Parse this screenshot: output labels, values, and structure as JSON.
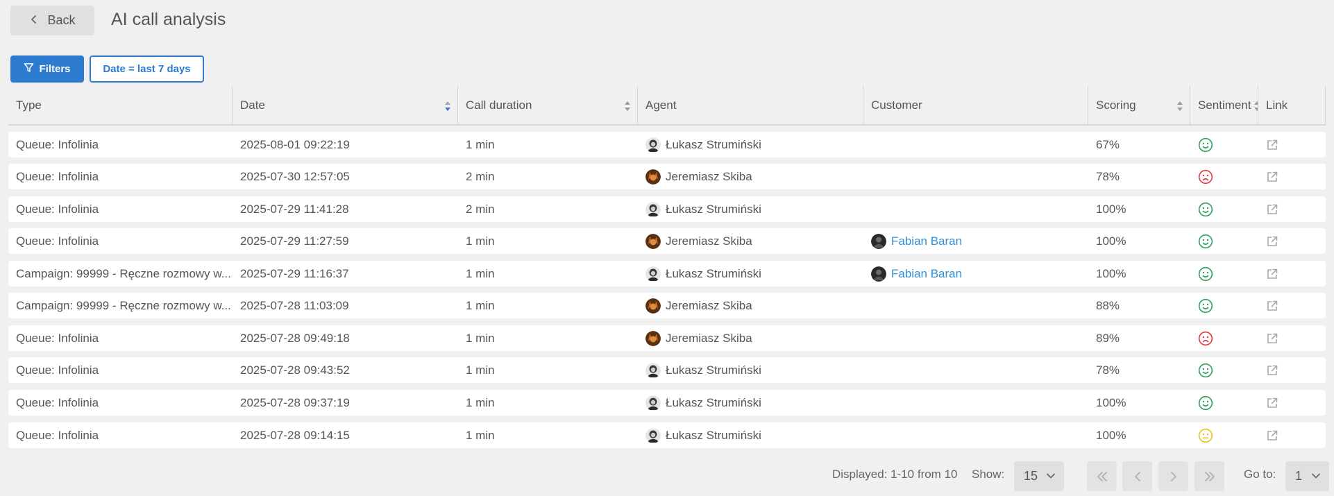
{
  "header": {
    "back_label": "Back",
    "title": "AI call analysis"
  },
  "filters": {
    "button_label": "Filters",
    "chips": [
      "Date = last 7 days"
    ]
  },
  "table": {
    "columns": [
      "Type",
      "Date",
      "Call duration",
      "Agent",
      "Customer",
      "Scoring",
      "Sentiment",
      "Link"
    ],
    "sortable_columns": [
      "Date",
      "Call duration",
      "Scoring",
      "Sentiment"
    ],
    "active_sort": {
      "column": "Date"
    },
    "rows": [
      {
        "type": "Queue: Infolinia",
        "date": "2025-08-01 09:22:19",
        "duration": "1 min",
        "agent": "Łukasz Strumiński",
        "customer": "",
        "scoring": "67%",
        "sentiment": "positive"
      },
      {
        "type": "Queue: Infolinia",
        "date": "2025-07-30 12:57:05",
        "duration": "2 min",
        "agent": "Jeremiasz Skiba",
        "customer": "",
        "scoring": "78%",
        "sentiment": "negative"
      },
      {
        "type": "Queue: Infolinia",
        "date": "2025-07-29 11:41:28",
        "duration": "2 min",
        "agent": "Łukasz Strumiński",
        "customer": "",
        "scoring": "100%",
        "sentiment": "positive"
      },
      {
        "type": "Queue: Infolinia",
        "date": "2025-07-29 11:27:59",
        "duration": "1 min",
        "agent": "Jeremiasz Skiba",
        "customer": "Fabian Baran",
        "scoring": "100%",
        "sentiment": "positive"
      },
      {
        "type": "Campaign: 99999 - Ręczne rozmowy w...",
        "date": "2025-07-29 11:16:37",
        "duration": "1 min",
        "agent": "Łukasz Strumiński",
        "customer": "Fabian Baran",
        "scoring": "100%",
        "sentiment": "positive"
      },
      {
        "type": "Campaign: 99999 - Ręczne rozmowy w...",
        "date": "2025-07-28 11:03:09",
        "duration": "1 min",
        "agent": "Jeremiasz Skiba",
        "customer": "",
        "scoring": "88%",
        "sentiment": "positive"
      },
      {
        "type": "Queue: Infolinia",
        "date": "2025-07-28 09:49:18",
        "duration": "1 min",
        "agent": "Jeremiasz Skiba",
        "customer": "",
        "scoring": "89%",
        "sentiment": "negative"
      },
      {
        "type": "Queue: Infolinia",
        "date": "2025-07-28 09:43:52",
        "duration": "1 min",
        "agent": "Łukasz Strumiński",
        "customer": "",
        "scoring": "78%",
        "sentiment": "positive"
      },
      {
        "type": "Queue: Infolinia",
        "date": "2025-07-28 09:37:19",
        "duration": "1 min",
        "agent": "Łukasz Strumiński",
        "customer": "",
        "scoring": "100%",
        "sentiment": "positive"
      },
      {
        "type": "Queue: Infolinia",
        "date": "2025-07-28 09:14:15",
        "duration": "1 min",
        "agent": "Łukasz Strumiński",
        "customer": "",
        "scoring": "100%",
        "sentiment": "neutral"
      }
    ]
  },
  "footer": {
    "displayed_text": "Displayed: 1-10 from 10",
    "show_label": "Show:",
    "show_value": "15",
    "goto_label": "Go to:",
    "goto_value": "1"
  },
  "icons": {
    "back": "chevron-left-icon",
    "filter": "funnel-icon",
    "link": "external-link-icon",
    "sentiment_positive": "smile-icon",
    "sentiment_negative": "frown-icon",
    "sentiment_neutral": "neutral-face-icon",
    "pagination": [
      "first-page-icon",
      "prev-page-icon",
      "next-page-icon",
      "last-page-icon"
    ]
  },
  "colors": {
    "primary": "#2c7bd1",
    "link": "#2f8fd6",
    "positive": "#2e9e5b",
    "negative": "#e0393e",
    "neutral": "#e8c21a",
    "background": "#f0f0f0"
  }
}
